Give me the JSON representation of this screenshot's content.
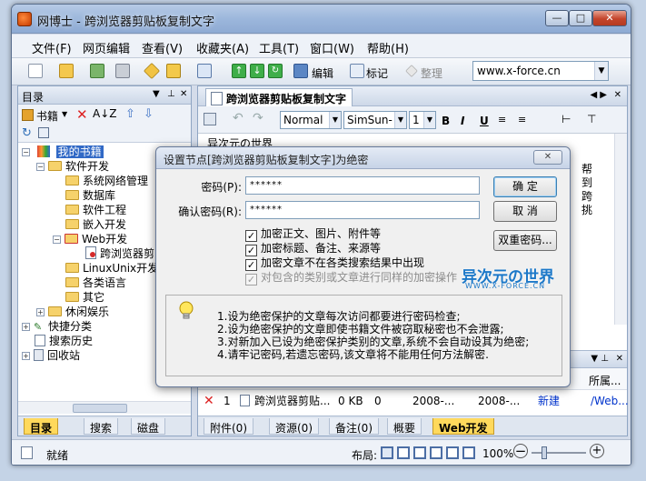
{
  "window": {
    "title": "网博士 - 跨浏览器剪贴板复制文字"
  },
  "menu": [
    "文件(F)",
    "网页编辑",
    "查看(V)",
    "收藏夹(A)",
    "工具(T)",
    "窗口(W)",
    "帮助(H)"
  ],
  "toolbar": {
    "edit_label": "编辑",
    "mark_label": "标记",
    "tidy_label": "整理",
    "address": "www.x-force.cn"
  },
  "left_panel": {
    "title": "目录",
    "bookmarks_label": "书籍",
    "tree": [
      {
        "label": "我的书籍",
        "depth": 0,
        "kind": "book",
        "selected": true
      },
      {
        "label": "软件开发",
        "depth": 1,
        "kind": "folder"
      },
      {
        "label": "系统网络管理",
        "depth": 2,
        "kind": "folder"
      },
      {
        "label": "数据库",
        "depth": 2,
        "kind": "folder"
      },
      {
        "label": "软件工程",
        "depth": 2,
        "kind": "folder"
      },
      {
        "label": "嵌入开发",
        "depth": 2,
        "kind": "folder"
      },
      {
        "label": "Web开发",
        "depth": 2,
        "kind": "folder"
      },
      {
        "label": "跨浏览器剪",
        "depth": 3,
        "kind": "doc"
      },
      {
        "label": "LinuxUnix开发",
        "depth": 2,
        "kind": "folder"
      },
      {
        "label": "各类语言",
        "depth": 2,
        "kind": "folder"
      },
      {
        "label": "其它",
        "depth": 2,
        "kind": "folder"
      },
      {
        "label": "休闲娱乐",
        "depth": 1,
        "kind": "folder"
      },
      {
        "label": "快捷分类",
        "depth": 0,
        "kind": "special"
      },
      {
        "label": "搜索历史",
        "depth": 0,
        "kind": "special"
      },
      {
        "label": "回收站",
        "depth": 0,
        "kind": "special"
      }
    ],
    "tabs": [
      "目录",
      "搜索",
      "磁盘"
    ]
  },
  "editor": {
    "tab_title": "跨浏览器剪贴板复制文字",
    "style": "Normal",
    "font": "SimSun-",
    "size": "1",
    "bold": "B",
    "italic": "I",
    "underline": "U",
    "content_first_line": "异次元の世界",
    "content_side": [
      "帮",
      "到",
      "跨",
      "挑"
    ]
  },
  "attachments": {
    "header_right": "所属...",
    "row": {
      "index": "1",
      "name": "跨浏览器剪贴...",
      "size": "0 KB",
      "count": "0",
      "date1": "2008-...",
      "date2": "2008-...",
      "status": "新建",
      "path": "/Web..."
    }
  },
  "bottom_tabs": [
    "附件(0)",
    "资源(0)",
    "备注(0)",
    "概要",
    "Web开发"
  ],
  "statusbar": {
    "text": "就绪",
    "layout_label": "布局:",
    "zoom": "100%"
  },
  "dialog": {
    "title": "设置节点[跨浏览器剪贴板复制文字]为绝密",
    "password_label": "密码(P):",
    "password_value": "******",
    "confirm_label": "确认密码(R):",
    "confirm_value": "******",
    "ok": "确 定",
    "cancel": "取 消",
    "double_pwd": "双重密码...",
    "options": [
      {
        "label": "加密正文、图片、附件等",
        "checked": true,
        "disabled": false
      },
      {
        "label": "加密标题、备注、来源等",
        "checked": true,
        "disabled": false
      },
      {
        "label": "加密文章不在各类搜索结果中出现",
        "checked": true,
        "disabled": false
      },
      {
        "label": "对包含的类别或文章进行同样的加密操作",
        "checked": true,
        "disabled": true
      }
    ],
    "notes": [
      "1.设为绝密保护的文章每次访问都要进行密码检查;",
      "2.设为绝密保护的文章即使书籍文件被窃取秘密也不会泄露;",
      "3.对新加入已设为绝密保护类别的文章,系统不会自动设其为绝密;",
      "4.请牢记密码,若遗忘密码,该文章将不能用任何方法解密."
    ]
  },
  "watermark": {
    "main": "异次元の世界",
    "sub": "WWW.X-FORCE.CN"
  },
  "colors": {
    "selection": "#3169c6",
    "accent_link": "#0033cc",
    "close_red": "#c4442b"
  }
}
